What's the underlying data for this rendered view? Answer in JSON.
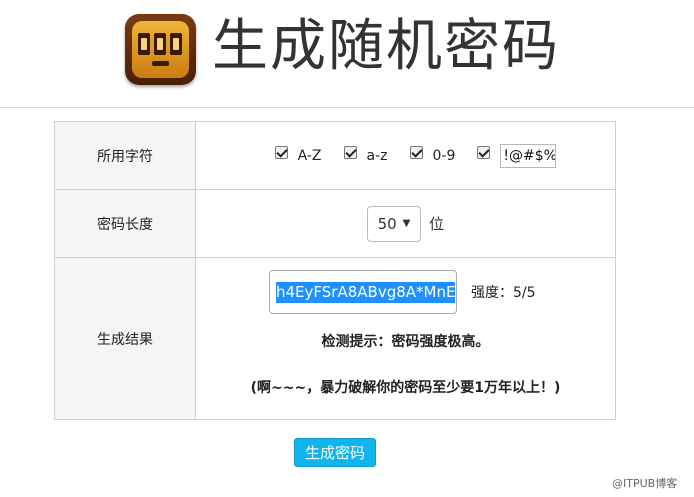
{
  "header": {
    "title": "生成随机密码",
    "logo_icon": "slot-machine-icon"
  },
  "form": {
    "chars": {
      "label": "所用字符",
      "options": [
        {
          "label": "A-Z",
          "checked": true
        },
        {
          "label": "a-z",
          "checked": true
        },
        {
          "label": "0-9",
          "checked": true
        }
      ],
      "special_checked": true,
      "special_value": "!@#$%"
    },
    "length": {
      "label": "密码长度",
      "selected": "50",
      "unit": "位"
    },
    "result": {
      "label": "生成结果",
      "value": "h4EyFSrA8ABvg8A*MnE",
      "strength": "强度：5/5",
      "hint": "检测提示：密码强度极高。",
      "note": "(啊~~~，暴力破解你的密码至少要1万年以上！)"
    }
  },
  "actions": {
    "generate_label": "生成密码"
  },
  "watermark": "@ITPUB博客",
  "colors": {
    "button": "#12b4ec",
    "selection": "#1e90ff"
  }
}
